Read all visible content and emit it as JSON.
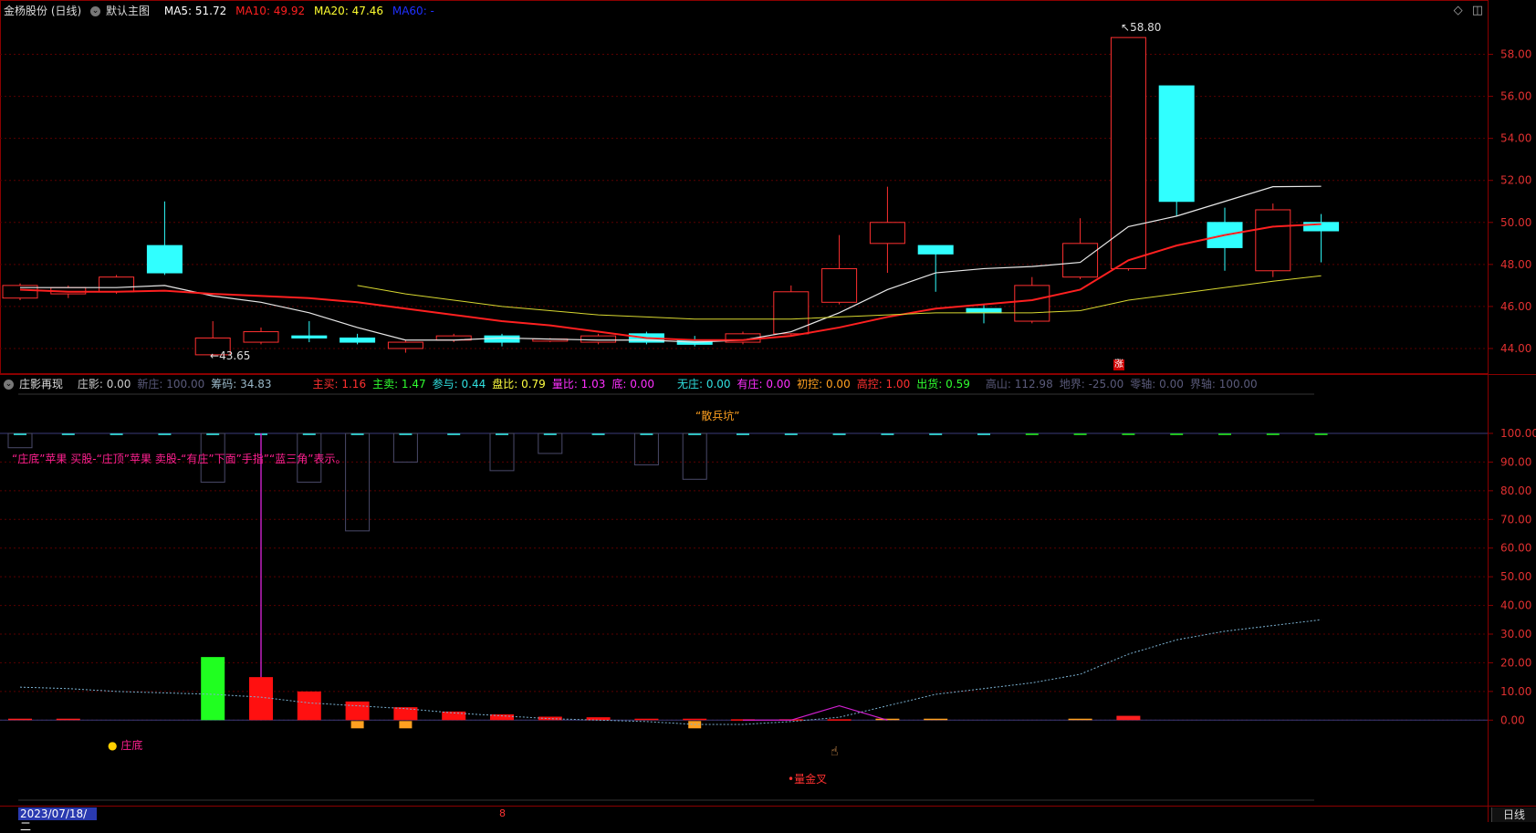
{
  "main_header": {
    "stock": "金杨股份 (日线)",
    "template": "默认主图",
    "ma5": {
      "label": "MA5: 51.72",
      "color": "#ffffff"
    },
    "ma10": {
      "label": "MA10: 49.92",
      "color": "#ff2020"
    },
    "ma20": {
      "label": "MA20: 47.46",
      "color": "#ffff30"
    },
    "ma60": {
      "label": "MA60: -",
      "color": "#2030ff"
    }
  },
  "price_axis": [
    "58.00",
    "56.00",
    "54.00",
    "52.00",
    "50.00",
    "48.00",
    "46.00",
    "44.00"
  ],
  "annotations": {
    "high": "58.80",
    "low": "43.65",
    "zhang": "涨"
  },
  "indicator_header": {
    "name": "庄影再现",
    "items": [
      {
        "text": "庄影: 0.00",
        "color": "#cccccc"
      },
      {
        "text": "新庄: 100.00",
        "color": "#5a5a7a"
      },
      {
        "text": "筹码: 34.83",
        "color": "#9ab8c8"
      },
      {
        "text": "主买: 1.16",
        "color": "#ff3030"
      },
      {
        "text": "主卖: 1.47",
        "color": "#30ff30"
      },
      {
        "text": "参与: 0.44",
        "color": "#30e0e0"
      },
      {
        "text": "盘比: 0.79",
        "color": "#ffff40"
      },
      {
        "text": "量比: 1.03",
        "color": "#ff30ff"
      },
      {
        "text": "底: 0.00",
        "color": "#ff30ff"
      },
      {
        "text": "无庄: 0.00",
        "color": "#30e0e0"
      },
      {
        "text": "有庄: 0.00",
        "color": "#ff30ff"
      },
      {
        "text": "初控: 0.00",
        "color": "#ffa020"
      },
      {
        "text": "高控: 1.00",
        "color": "#ff3030"
      },
      {
        "text": "出货: 0.59",
        "color": "#30ff30"
      },
      {
        "text": "高山: 112.98",
        "color": "#5a5a7a"
      },
      {
        "text": "地界: -25.00",
        "color": "#5a5a7a"
      },
      {
        "text": "零轴: 0.00",
        "color": "#5a5a7a"
      },
      {
        "text": "界轴: 100.00",
        "color": "#5a5a7a"
      }
    ]
  },
  "indicator_axis": [
    "100.00",
    "90.00",
    "80.00",
    "70.00",
    "60.00",
    "50.00",
    "40.00",
    "30.00",
    "20.00",
    "10.00",
    "0.00"
  ],
  "indicator_texts": {
    "sanbing": "“散兵坑”",
    "legend": "“庄底”苹果 买股-“庄顶”苹果 卖股-“有庄”下面”手指”“蓝三角”表示。",
    "zhuangdi": "庄底",
    "jinchaa": "量金叉"
  },
  "footer": {
    "date": "2023/07/18/二",
    "mark": "8",
    "period": "日线"
  },
  "chart_data": {
    "type": "candlestick",
    "ylim": [
      43.0,
      59.5
    ],
    "candles": [
      {
        "o": 46.4,
        "c": 47.0,
        "h": 47.1,
        "l": 46.3
      },
      {
        "o": 46.6,
        "c": 46.9,
        "h": 47.0,
        "l": 46.4
      },
      {
        "o": 46.7,
        "c": 47.4,
        "h": 47.5,
        "l": 46.6
      },
      {
        "o": 48.9,
        "c": 47.6,
        "h": 51.0,
        "l": 47.5
      },
      {
        "o": 43.7,
        "c": 44.5,
        "h": 45.3,
        "l": 43.65
      },
      {
        "o": 44.3,
        "c": 44.8,
        "h": 45.0,
        "l": 44.2
      },
      {
        "o": 44.6,
        "c": 44.5,
        "h": 45.3,
        "l": 44.3
      },
      {
        "o": 44.5,
        "c": 44.3,
        "h": 44.7,
        "l": 44.2
      },
      {
        "o": 44.0,
        "c": 44.3,
        "h": 44.4,
        "l": 43.8
      },
      {
        "o": 44.4,
        "c": 44.6,
        "h": 44.7,
        "l": 44.3
      },
      {
        "o": 44.6,
        "c": 44.3,
        "h": 44.7,
        "l": 44.1
      },
      {
        "o": 44.35,
        "c": 44.45,
        "h": 44.5,
        "l": 44.3
      },
      {
        "o": 44.3,
        "c": 44.6,
        "h": 44.7,
        "l": 44.2
      },
      {
        "o": 44.7,
        "c": 44.3,
        "h": 44.8,
        "l": 44.2
      },
      {
        "o": 44.4,
        "c": 44.2,
        "h": 44.6,
        "l": 44.1
      },
      {
        "o": 44.3,
        "c": 44.7,
        "h": 44.8,
        "l": 44.2
      },
      {
        "o": 44.7,
        "c": 46.7,
        "h": 47.0,
        "l": 44.6
      },
      {
        "o": 46.2,
        "c": 47.8,
        "h": 49.4,
        "l": 46.1
      },
      {
        "o": 49.0,
        "c": 50.0,
        "h": 51.7,
        "l": 47.6
      },
      {
        "o": 48.9,
        "c": 48.5,
        "h": 48.9,
        "l": 46.7
      },
      {
        "o": 45.9,
        "c": 45.7,
        "h": 46.1,
        "l": 45.2
      },
      {
        "o": 45.3,
        "c": 47.0,
        "h": 47.4,
        "l": 45.2
      },
      {
        "o": 47.4,
        "c": 49.0,
        "h": 50.2,
        "l": 47.3
      },
      {
        "o": 47.8,
        "c": 58.8,
        "h": 58.8,
        "l": 47.7
      },
      {
        "o": 56.5,
        "c": 51.0,
        "h": 56.5,
        "l": 50.3
      },
      {
        "o": 50.0,
        "c": 48.8,
        "h": 50.7,
        "l": 47.7
      },
      {
        "o": 47.7,
        "c": 50.6,
        "h": 50.9,
        "l": 47.4
      },
      {
        "o": 50.0,
        "c": 49.6,
        "h": 50.4,
        "l": 48.1
      }
    ],
    "ma5": [
      46.9,
      46.9,
      46.9,
      47.0,
      46.5,
      46.2,
      45.7,
      45.0,
      44.4,
      44.4,
      44.5,
      44.45,
      44.4,
      44.4,
      44.3,
      44.4,
      44.8,
      45.7,
      46.8,
      47.6,
      47.8,
      47.9,
      48.1,
      49.8,
      50.3,
      51.0,
      51.7,
      51.72
    ],
    "ma10": [
      46.8,
      46.7,
      46.7,
      46.75,
      46.6,
      46.5,
      46.4,
      46.2,
      45.9,
      45.6,
      45.3,
      45.1,
      44.8,
      44.5,
      44.4,
      44.4,
      44.6,
      45.0,
      45.5,
      45.9,
      46.1,
      46.3,
      46.8,
      48.2,
      48.9,
      49.4,
      49.8,
      49.92
    ],
    "ma20": [
      null,
      null,
      null,
      null,
      null,
      null,
      null,
      47.0,
      46.6,
      46.3,
      46.0,
      45.8,
      45.6,
      45.5,
      45.4,
      45.4,
      45.4,
      45.5,
      45.6,
      45.7,
      45.7,
      45.7,
      45.8,
      46.3,
      46.6,
      46.9,
      47.2,
      47.46
    ],
    "ind_bars": [
      {
        "v": 0.5,
        "c": "#ff2020"
      },
      {
        "v": 0.5,
        "c": "#ff2020"
      },
      {
        "v": 0,
        "c": "#ff2020"
      },
      {
        "v": 0,
        "c": "#ff2020"
      },
      {
        "v": 22,
        "c": "#20ff20"
      },
      {
        "v": 15,
        "c": "#ff1010"
      },
      {
        "v": 10,
        "c": "#ff1010"
      },
      {
        "v": 6.5,
        "c": "#ff1010"
      },
      {
        "v": 4.5,
        "c": "#ff1010"
      },
      {
        "v": 3,
        "c": "#ff1010"
      },
      {
        "v": 2,
        "c": "#ff1010"
      },
      {
        "v": 1.2,
        "c": "#ff1010"
      },
      {
        "v": 1,
        "c": "#ff1010"
      },
      {
        "v": 0.5,
        "c": "#ff1010"
      },
      {
        "v": 0.5,
        "c": "#ff1010"
      },
      {
        "v": 0.3,
        "c": "#ff1010"
      },
      {
        "v": 0.3,
        "c": "#ff1010"
      },
      {
        "v": 0.3,
        "c": "#ff1010"
      },
      {
        "v": 0.5,
        "c": "#ffa020"
      },
      {
        "v": 0.5,
        "c": "#ffa020"
      },
      {
        "v": 0,
        "c": "#ffa020"
      },
      {
        "v": 0,
        "c": "#ffa020"
      },
      {
        "v": 0.5,
        "c": "#ffa020"
      },
      {
        "v": 1.5,
        "c": "#ff2020"
      },
      {
        "v": 0,
        "c": "#ff2020"
      },
      {
        "v": 0,
        "c": "#ff2020"
      },
      {
        "v": 0,
        "c": "#ff2020"
      },
      {
        "v": 0,
        "c": "#ff2020"
      }
    ],
    "ind_neg": [
      0,
      0,
      0,
      0,
      0,
      0,
      0,
      3,
      3,
      0,
      0,
      0,
      0,
      0,
      3,
      0,
      0,
      0,
      0,
      0,
      0,
      0,
      0,
      0,
      0,
      0,
      0,
      0
    ],
    "ind_top_boxes": [
      5,
      0,
      0,
      0,
      17,
      0,
      17,
      34,
      10,
      0,
      13,
      7,
      0,
      11,
      16,
      0,
      0,
      0,
      0,
      0,
      0,
      0,
      0,
      0,
      0,
      0,
      0,
      0
    ],
    "ind_dotted": [
      11.5,
      11,
      10,
      9.5,
      9,
      8,
      6,
      5,
      4,
      2.5,
      1.5,
      0.5,
      0,
      -0.5,
      -1.5,
      -1.5,
      -0.5,
      1,
      5,
      9,
      11,
      13,
      16,
      23,
      28,
      31,
      33,
      35
    ],
    "ind_magenta": [
      null,
      null,
      null,
      null,
      null,
      null,
      null,
      null,
      null,
      null,
      null,
      null,
      null,
      null,
      null,
      0,
      0,
      5,
      0,
      null,
      null,
      null,
      null,
      null,
      null,
      null,
      null,
      null
    ],
    "ind_ylim": [
      -5,
      100
    ]
  }
}
